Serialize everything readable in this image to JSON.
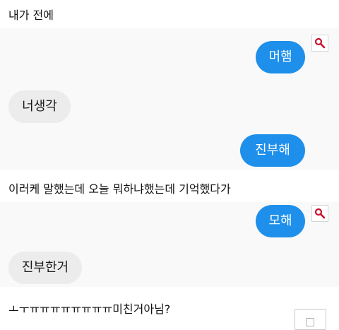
{
  "captions": [
    "내가 전에",
    "이러케 말했는데 오늘 뭐하냐했는데 기억했다가",
    "ㅗㅜㅠㅠㅠㅠㅠㅠㅠㅠ미친거아님?"
  ],
  "chat1": {
    "sent_1": "머햄",
    "received_1": "너생각",
    "sent_2": "진부해"
  },
  "chat2": {
    "sent_1": "모해",
    "received_1": "진부한거"
  },
  "icons": {
    "zoom": "magnifier-icon"
  },
  "colors": {
    "sent_bubble": "#1e8fea",
    "received_bubble": "#ececec",
    "chat_background": "#f9f9f9",
    "icon_red": "#c8102e"
  }
}
